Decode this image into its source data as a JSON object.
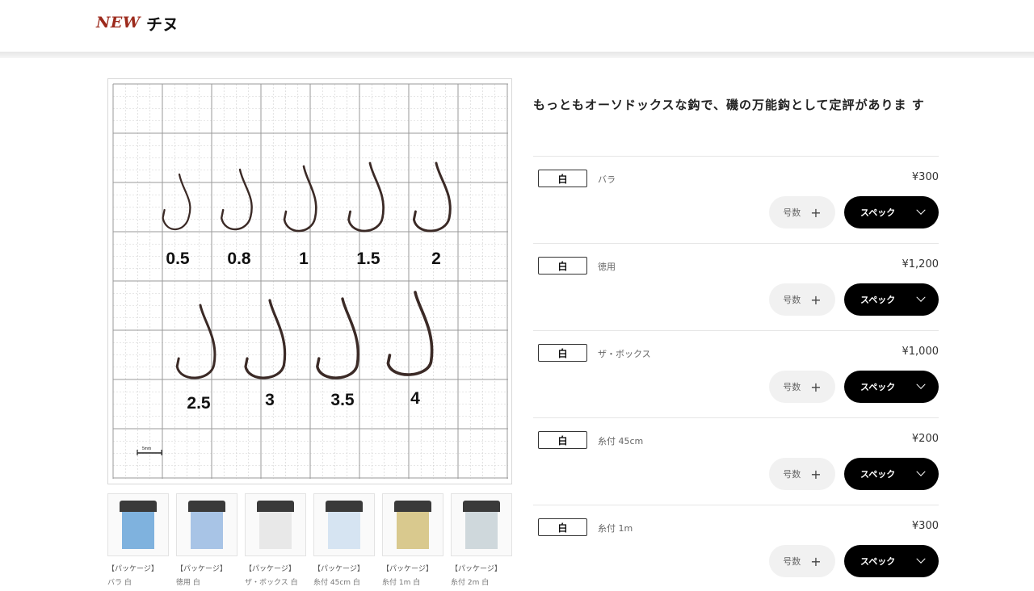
{
  "header": {
    "badge": "NEW",
    "title": "チヌ"
  },
  "chart": {
    "sizes_row1": [
      "0.5",
      "0.8",
      "1",
      "1.5",
      "2"
    ],
    "sizes_row2": [
      "2.5",
      "3",
      "3.5",
      "4"
    ],
    "scale_label": "5mm"
  },
  "thumbnails": [
    {
      "caption": "【パッケージ】",
      "name": "バラ 白",
      "color": "#7fb2de"
    },
    {
      "caption": "【パッケージ】",
      "name": "徳用 白",
      "color": "#a8c4e6"
    },
    {
      "caption": "【パッケージ】",
      "name": "ザ・ボックス 白",
      "color": "#e8e8e8"
    },
    {
      "caption": "【パッケージ】",
      "name": "糸付 45cm 白",
      "color": "#d6e4f2"
    },
    {
      "caption": "【パッケージ】",
      "name": "糸付 1m 白",
      "color": "#d9c98e"
    },
    {
      "caption": "【パッケージ】",
      "name": "糸付 2m 白",
      "color": "#cfd8dc"
    }
  ],
  "description": "もっともオーソドックスな鈎で、磯の万能鈎として定評がありま す",
  "products": [
    {
      "color": "白",
      "name": "バラ",
      "price": "¥300",
      "size_label": "号数",
      "size_plus": "+",
      "spec_label": "スペック"
    },
    {
      "color": "白",
      "name": "徳用",
      "price": "¥1,200",
      "size_label": "号数",
      "size_plus": "+",
      "spec_label": "スペック"
    },
    {
      "color": "白",
      "name": "ザ・ボックス",
      "price": "¥1,000",
      "size_label": "号数",
      "size_plus": "+",
      "spec_label": "スペック"
    },
    {
      "color": "白",
      "name": "糸付 45cm",
      "price": "¥200",
      "size_label": "号数",
      "size_plus": "+",
      "spec_label": "スペック"
    },
    {
      "color": "白",
      "name": "糸付 1m",
      "price": "¥300",
      "size_label": "号数",
      "size_plus": "+",
      "spec_label": "スペック"
    }
  ]
}
